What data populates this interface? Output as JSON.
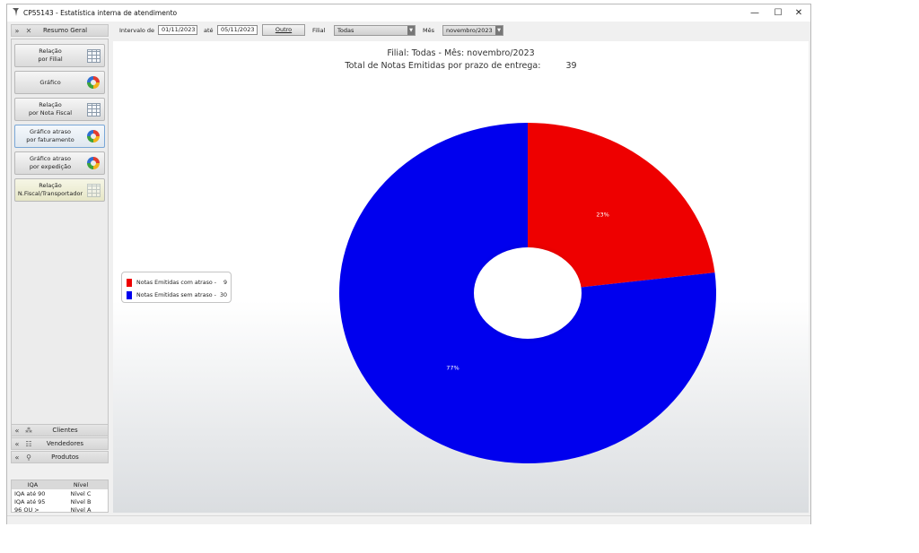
{
  "window": {
    "title": "CP55143 - Estatística interna de atendimento",
    "minimize_glyph": "—",
    "maximize_glyph": "☐",
    "close_glyph": "✕"
  },
  "sidebar": {
    "top_panel": {
      "label": "Resumo Geral",
      "icon": "expand-icon"
    },
    "items": [
      {
        "label": "Relação\npor Filial",
        "icon": "table-icon"
      },
      {
        "label": "Gráfico",
        "icon": "pie-chart-icon"
      },
      {
        "label": "Relação\npor Nota Fiscal",
        "icon": "table-icon"
      },
      {
        "label": "Gráfico atraso\npor faturamento",
        "icon": "pie-chart-icon"
      },
      {
        "label": "Gráfico atraso\npor expedição",
        "icon": "pie-chart-icon"
      },
      {
        "label": "Relação\nN.Fiscal/Transportador",
        "icon": "table-icon"
      }
    ],
    "bottom_panels": [
      {
        "label": "Clientes",
        "icon": "people-icon"
      },
      {
        "label": "Vendedores",
        "icon": "salesperson-icon"
      },
      {
        "label": "Produtos",
        "icon": "products-icon"
      }
    ],
    "iqa_table": {
      "headers": [
        "IQA",
        "Nível"
      ],
      "rows": [
        [
          "IQA até 90",
          "Nível C"
        ],
        [
          "IQA até 95",
          "Nível B"
        ],
        [
          "96 OU >",
          "Nível A"
        ]
      ]
    }
  },
  "toolbar": {
    "interval_label": "Intervalo de",
    "date_from": "01/11/2023",
    "until_label": "até",
    "date_to": "05/11/2023",
    "other_button": "Outro",
    "branch_label": "Filial",
    "branch_value": "Todas",
    "month_label": "Mês",
    "month_value": "novembro/2023"
  },
  "chart": {
    "title_line1": "Filial: Todas - Mês: novembro/2023",
    "title_line2_label": "Total de Notas Emitidas por prazo de entrega:",
    "title_line2_value": "39"
  },
  "chart_data": {
    "type": "pie",
    "donut": true,
    "categories": [
      "Notas Emitidas com atraso -",
      "Notas Emitidas sem atraso -"
    ],
    "values": [
      9,
      30
    ],
    "data_labels": [
      "23%",
      "77%"
    ],
    "colors": [
      "#ee0000",
      "#0000ee"
    ],
    "legend": "left"
  }
}
